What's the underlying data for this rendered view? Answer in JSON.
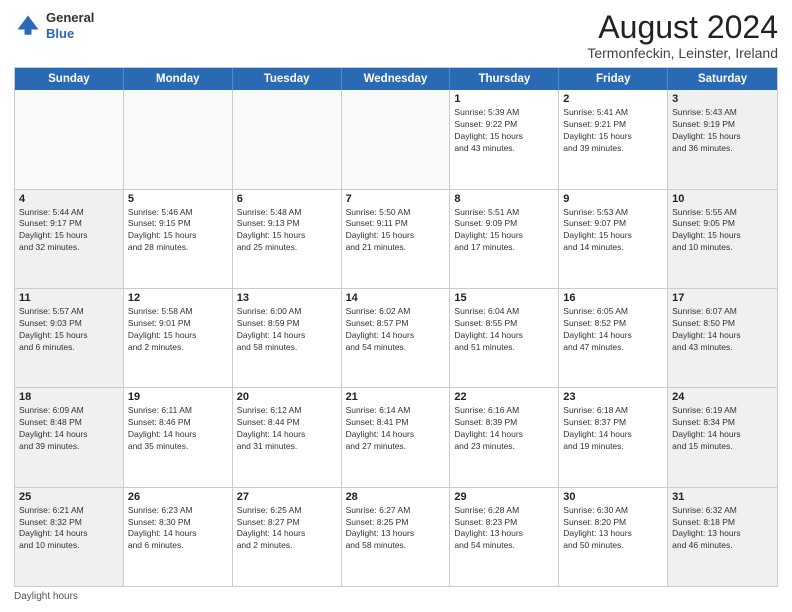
{
  "header": {
    "logo": {
      "general": "General",
      "blue": "Blue"
    },
    "title": "August 2024",
    "subtitle": "Termonfeckin, Leinster, Ireland"
  },
  "days_of_week": [
    "Sunday",
    "Monday",
    "Tuesday",
    "Wednesday",
    "Thursday",
    "Friday",
    "Saturday"
  ],
  "weeks": [
    [
      {
        "day": "",
        "info": ""
      },
      {
        "day": "",
        "info": ""
      },
      {
        "day": "",
        "info": ""
      },
      {
        "day": "",
        "info": ""
      },
      {
        "day": "1",
        "info": "Sunrise: 5:39 AM\nSunset: 9:22 PM\nDaylight: 15 hours\nand 43 minutes."
      },
      {
        "day": "2",
        "info": "Sunrise: 5:41 AM\nSunset: 9:21 PM\nDaylight: 15 hours\nand 39 minutes."
      },
      {
        "day": "3",
        "info": "Sunrise: 5:43 AM\nSunset: 9:19 PM\nDaylight: 15 hours\nand 36 minutes."
      }
    ],
    [
      {
        "day": "4",
        "info": "Sunrise: 5:44 AM\nSunset: 9:17 PM\nDaylight: 15 hours\nand 32 minutes."
      },
      {
        "day": "5",
        "info": "Sunrise: 5:46 AM\nSunset: 9:15 PM\nDaylight: 15 hours\nand 28 minutes."
      },
      {
        "day": "6",
        "info": "Sunrise: 5:48 AM\nSunset: 9:13 PM\nDaylight: 15 hours\nand 25 minutes."
      },
      {
        "day": "7",
        "info": "Sunrise: 5:50 AM\nSunset: 9:11 PM\nDaylight: 15 hours\nand 21 minutes."
      },
      {
        "day": "8",
        "info": "Sunrise: 5:51 AM\nSunset: 9:09 PM\nDaylight: 15 hours\nand 17 minutes."
      },
      {
        "day": "9",
        "info": "Sunrise: 5:53 AM\nSunset: 9:07 PM\nDaylight: 15 hours\nand 14 minutes."
      },
      {
        "day": "10",
        "info": "Sunrise: 5:55 AM\nSunset: 9:05 PM\nDaylight: 15 hours\nand 10 minutes."
      }
    ],
    [
      {
        "day": "11",
        "info": "Sunrise: 5:57 AM\nSunset: 9:03 PM\nDaylight: 15 hours\nand 6 minutes."
      },
      {
        "day": "12",
        "info": "Sunrise: 5:58 AM\nSunset: 9:01 PM\nDaylight: 15 hours\nand 2 minutes."
      },
      {
        "day": "13",
        "info": "Sunrise: 6:00 AM\nSunset: 8:59 PM\nDaylight: 14 hours\nand 58 minutes."
      },
      {
        "day": "14",
        "info": "Sunrise: 6:02 AM\nSunset: 8:57 PM\nDaylight: 14 hours\nand 54 minutes."
      },
      {
        "day": "15",
        "info": "Sunrise: 6:04 AM\nSunset: 8:55 PM\nDaylight: 14 hours\nand 51 minutes."
      },
      {
        "day": "16",
        "info": "Sunrise: 6:05 AM\nSunset: 8:52 PM\nDaylight: 14 hours\nand 47 minutes."
      },
      {
        "day": "17",
        "info": "Sunrise: 6:07 AM\nSunset: 8:50 PM\nDaylight: 14 hours\nand 43 minutes."
      }
    ],
    [
      {
        "day": "18",
        "info": "Sunrise: 6:09 AM\nSunset: 8:48 PM\nDaylight: 14 hours\nand 39 minutes."
      },
      {
        "day": "19",
        "info": "Sunrise: 6:11 AM\nSunset: 8:46 PM\nDaylight: 14 hours\nand 35 minutes."
      },
      {
        "day": "20",
        "info": "Sunrise: 6:12 AM\nSunset: 8:44 PM\nDaylight: 14 hours\nand 31 minutes."
      },
      {
        "day": "21",
        "info": "Sunrise: 6:14 AM\nSunset: 8:41 PM\nDaylight: 14 hours\nand 27 minutes."
      },
      {
        "day": "22",
        "info": "Sunrise: 6:16 AM\nSunset: 8:39 PM\nDaylight: 14 hours\nand 23 minutes."
      },
      {
        "day": "23",
        "info": "Sunrise: 6:18 AM\nSunset: 8:37 PM\nDaylight: 14 hours\nand 19 minutes."
      },
      {
        "day": "24",
        "info": "Sunrise: 6:19 AM\nSunset: 8:34 PM\nDaylight: 14 hours\nand 15 minutes."
      }
    ],
    [
      {
        "day": "25",
        "info": "Sunrise: 6:21 AM\nSunset: 8:32 PM\nDaylight: 14 hours\nand 10 minutes."
      },
      {
        "day": "26",
        "info": "Sunrise: 6:23 AM\nSunset: 8:30 PM\nDaylight: 14 hours\nand 6 minutes."
      },
      {
        "day": "27",
        "info": "Sunrise: 6:25 AM\nSunset: 8:27 PM\nDaylight: 14 hours\nand 2 minutes."
      },
      {
        "day": "28",
        "info": "Sunrise: 6:27 AM\nSunset: 8:25 PM\nDaylight: 13 hours\nand 58 minutes."
      },
      {
        "day": "29",
        "info": "Sunrise: 6:28 AM\nSunset: 8:23 PM\nDaylight: 13 hours\nand 54 minutes."
      },
      {
        "day": "30",
        "info": "Sunrise: 6:30 AM\nSunset: 8:20 PM\nDaylight: 13 hours\nand 50 minutes."
      },
      {
        "day": "31",
        "info": "Sunrise: 6:32 AM\nSunset: 8:18 PM\nDaylight: 13 hours\nand 46 minutes."
      }
    ]
  ],
  "footer": {
    "note": "Daylight hours"
  },
  "colors": {
    "header_bg": "#2a6ab5",
    "header_text": "#ffffff",
    "cell_border": "#cccccc",
    "shaded": "#f0f0f0"
  }
}
